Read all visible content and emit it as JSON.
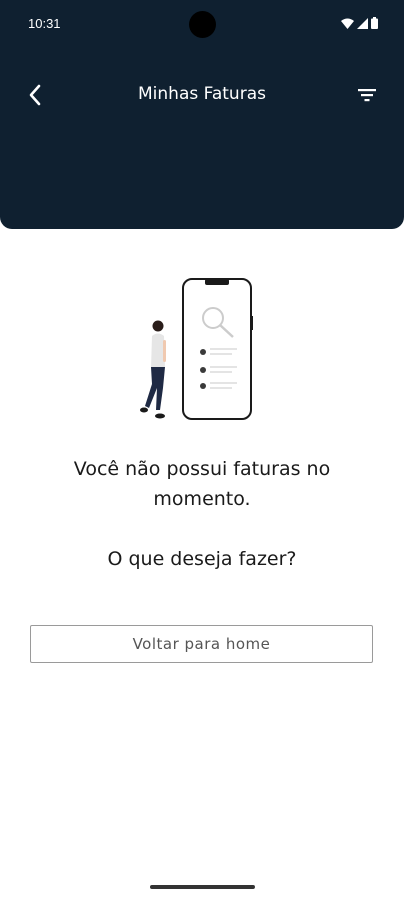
{
  "status_bar": {
    "time": "10:31",
    "icons": [
      "wifi-icon",
      "signal-icon",
      "battery-icon"
    ]
  },
  "app_bar": {
    "title": "Minhas Faturas",
    "back_icon": "chevron-left-icon",
    "filter_icon": "filter-icon"
  },
  "empty_state": {
    "illustration": "person-with-phone-search-illustration",
    "message": "Você não possui faturas no momento.",
    "question": "O que deseja fazer?"
  },
  "actions": {
    "home_button_label": "Voltar para home"
  },
  "colors": {
    "header_bg": "#0f2030",
    "text": "#1a1a1a",
    "button_border": "#9a9a9a"
  }
}
